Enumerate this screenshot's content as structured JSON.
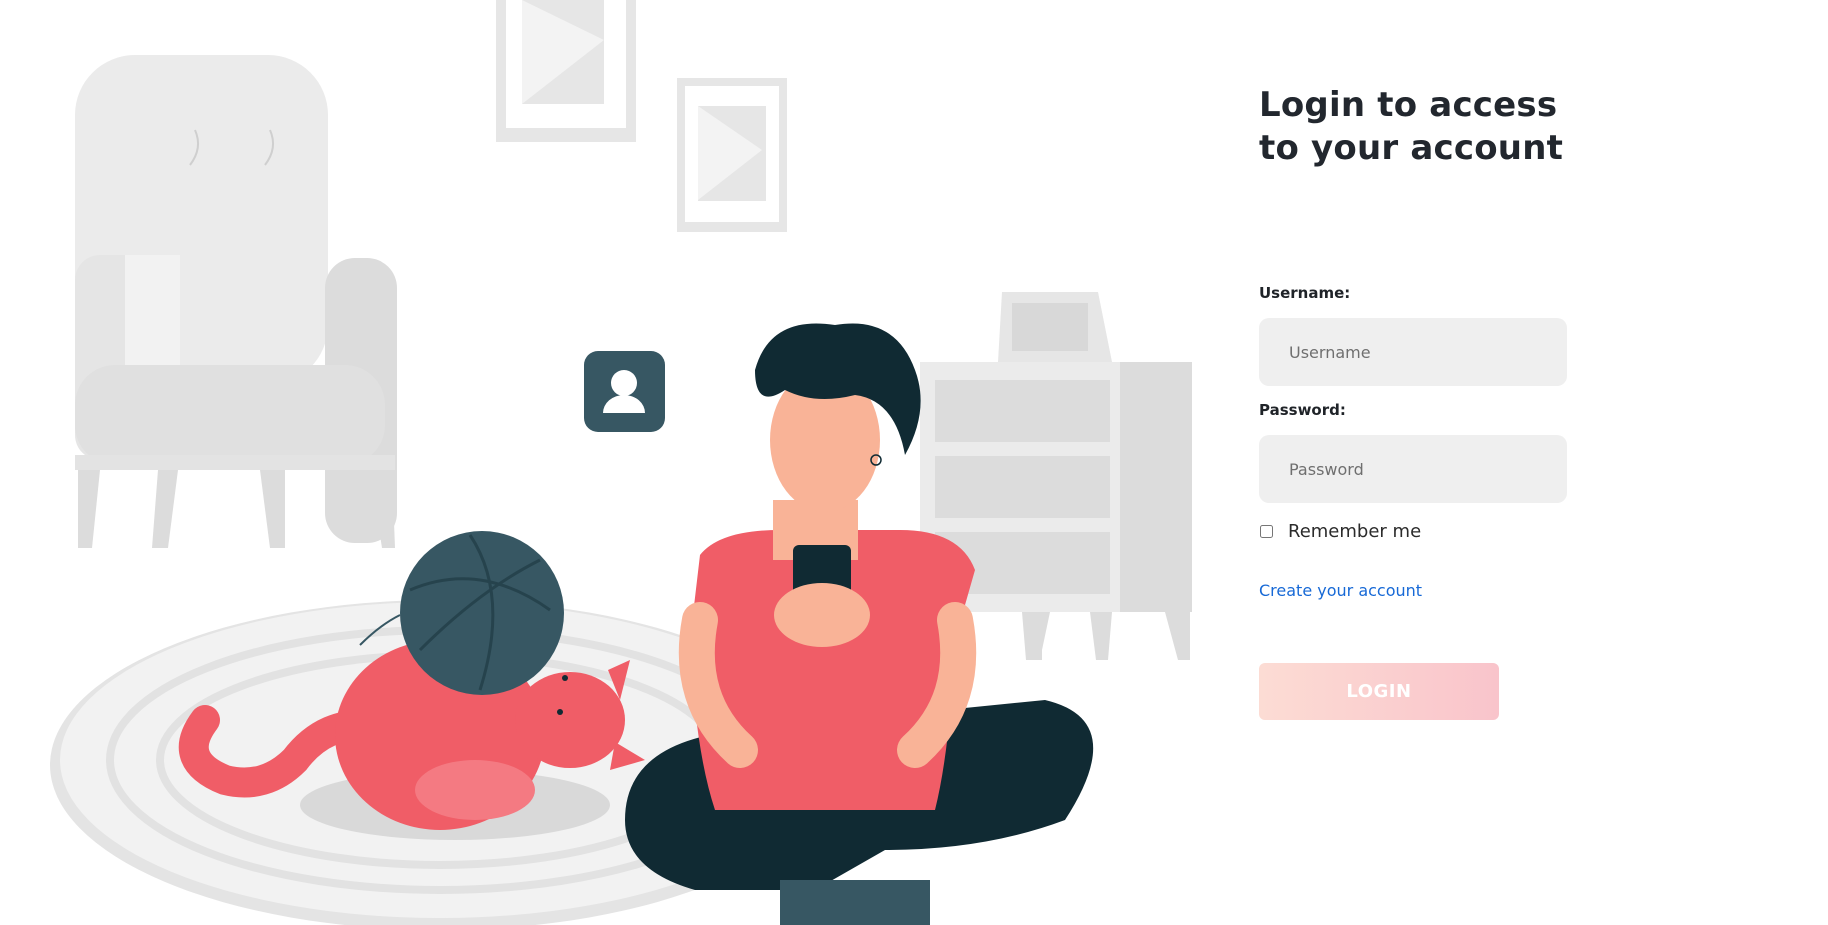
{
  "login": {
    "title": "Login to access to your account",
    "username_label": "Username:",
    "username_placeholder": "Username",
    "password_label": "Password:",
    "password_placeholder": "Password",
    "remember_label": "Remember me",
    "create_account_link": "Create your account",
    "login_button": "LOGIN"
  },
  "colors": {
    "button_gradient_start": "#fcdcd4",
    "button_gradient_end": "#f9c4cb",
    "link": "#1769d6",
    "input_background": "#efefef",
    "illustration_accent": "#f05d67",
    "illustration_dark": "#102a33"
  },
  "illustration": {
    "icons": [
      "armchair",
      "picture-frame",
      "picture-frame",
      "cabinet",
      "user-avatar-icon",
      "yarn-ball",
      "cat",
      "rug",
      "person-with-phone"
    ]
  }
}
